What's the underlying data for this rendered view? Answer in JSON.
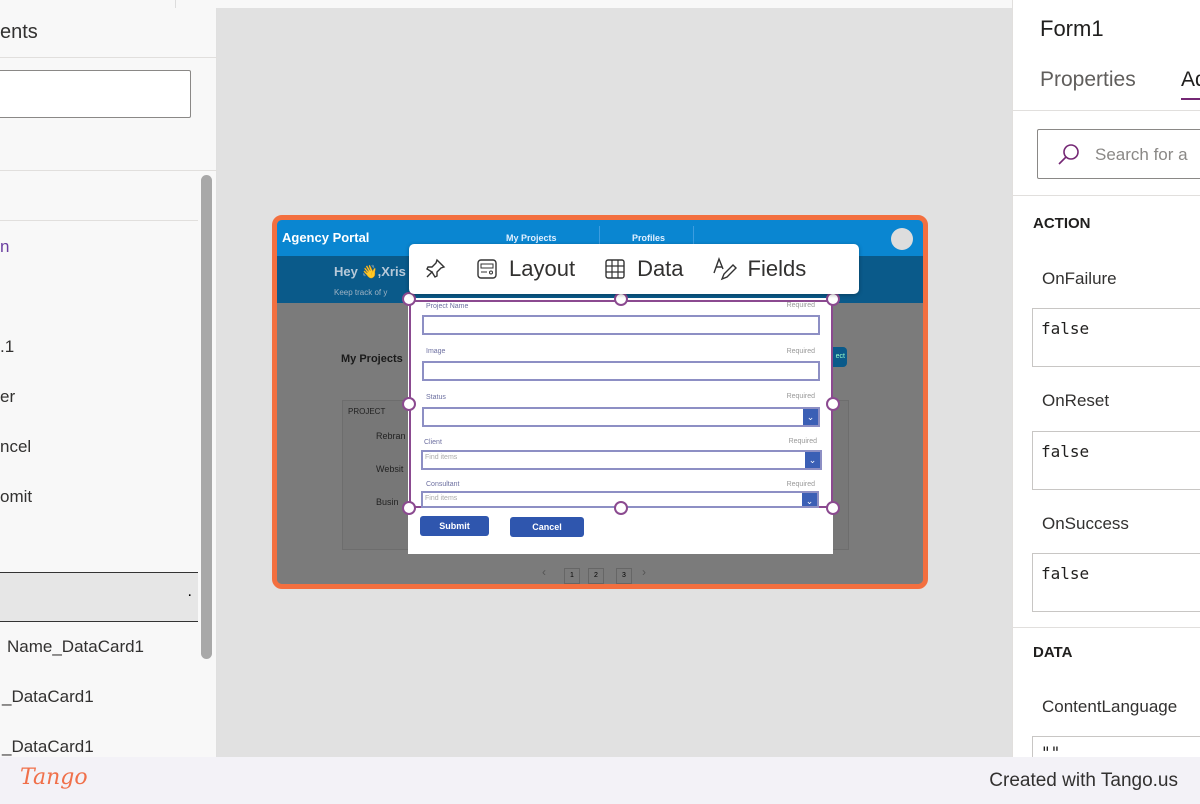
{
  "left_panel": {
    "title": "ents",
    "items": [
      "n",
      ".1",
      "er",
      "ncel",
      "omit"
    ],
    "selected_item": ".",
    "children": [
      "Name_DataCard1",
      "_DataCard1",
      "_DataCard1"
    ]
  },
  "app": {
    "title": "Agency Portal",
    "nav": [
      "My Projects",
      "Profiles"
    ],
    "greeting": "Hey 👋,Xris",
    "subtitle": "Keep track of y",
    "section": "My Projects",
    "new_button": "ect",
    "table_header": "PROJECT",
    "rows": [
      "Rebran",
      "Websit",
      "Busin"
    ],
    "pages": [
      "1",
      "2",
      "3"
    ]
  },
  "toolbar": {
    "layout": "Layout",
    "data": "Data",
    "fields": "Fields"
  },
  "form": {
    "fields": [
      {
        "label": "Project Name",
        "required": "Required",
        "type": "text",
        "placeholder": ""
      },
      {
        "label": "Image",
        "required": "Required",
        "type": "text",
        "placeholder": ""
      },
      {
        "label": "Status",
        "required": "Required",
        "type": "dropdown",
        "placeholder": ""
      },
      {
        "label": "Client",
        "required": "Required",
        "type": "combobox",
        "placeholder": "Find items"
      },
      {
        "label": "Consultant",
        "required": "Required",
        "type": "combobox",
        "placeholder": "Find items"
      }
    ],
    "submit": "Submit",
    "cancel": "Cancel"
  },
  "right_panel": {
    "title": "Form1",
    "tabs": [
      "Properties",
      "Ad"
    ],
    "search_placeholder": "Search for a",
    "sections": [
      {
        "name": "ACTION",
        "props": [
          {
            "name": "OnFailure",
            "value": "false"
          },
          {
            "name": "OnReset",
            "value": "false"
          },
          {
            "name": "OnSuccess",
            "value": "false"
          }
        ]
      },
      {
        "name": "DATA",
        "props": [
          {
            "name": "ContentLanguage",
            "value": "\"\""
          }
        ]
      }
    ]
  },
  "footer": {
    "logo": "Tango",
    "credit": "Created with Tango.us"
  },
  "colors": {
    "highlight": "#f36f3f",
    "app_header": "#0a86d1",
    "button": "#2f56ae",
    "selection": "#8b4a90"
  }
}
